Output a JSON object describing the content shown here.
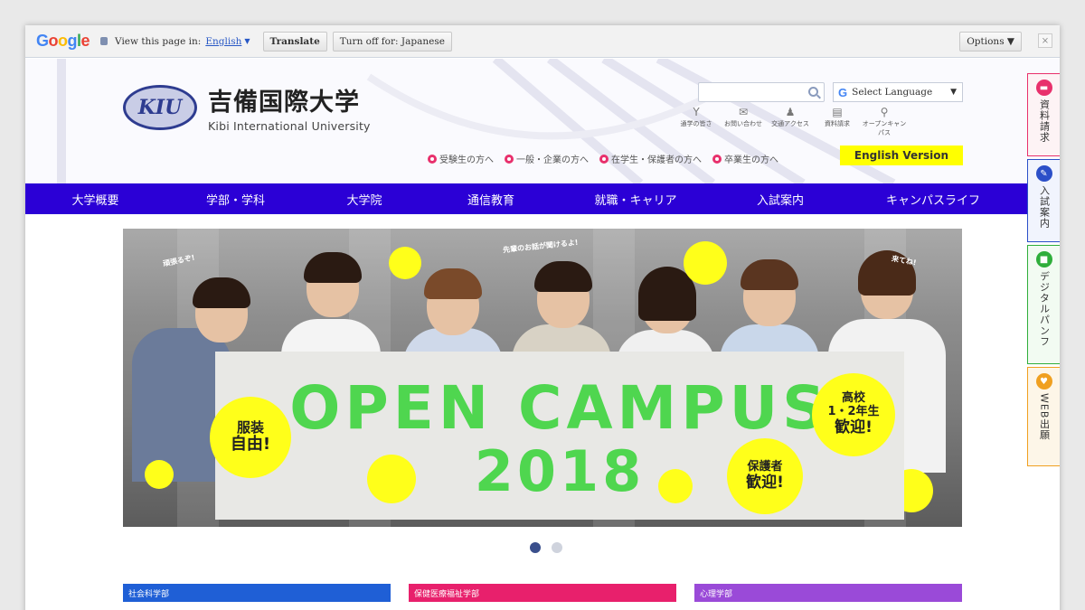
{
  "translate_bar": {
    "view_label": "View this page in:",
    "language": "English",
    "translate_btn": "Translate",
    "turn_off_btn": "Turn off for: Japanese",
    "options_btn": "Options ▼",
    "close": "×"
  },
  "header": {
    "logo_mark": "KIU",
    "logo_jp": "吉備国際大学",
    "logo_en": "Kibi International University",
    "search_placeholder": "",
    "select_language": "Select Language",
    "utilities": [
      {
        "icon": "antenna-icon",
        "glyph": "Y",
        "label": "通学の皆さ"
      },
      {
        "icon": "mail-icon",
        "glyph": "✉",
        "label": "お問い合わせ"
      },
      {
        "icon": "person-icon",
        "glyph": "♟",
        "label": "交通アクセス"
      },
      {
        "icon": "document-icon",
        "glyph": "▤",
        "label": "資料請求"
      },
      {
        "icon": "bicycle-icon",
        "glyph": "⚲",
        "label": "オープンキャンパス"
      }
    ],
    "audience_links": [
      "受験生の方へ",
      "一般・企業の方へ",
      "在学生・保護者の方へ",
      "卒業生の方へ"
    ],
    "english_version": "English Version"
  },
  "nav": {
    "items": [
      "大学概要",
      "学部・学科",
      "大学院",
      "通信教育",
      "就職・キャリア",
      "入試案内",
      "キャンパスライフ"
    ]
  },
  "side_tabs": [
    {
      "label": "資料請求",
      "icon": "document-icon",
      "color": "#e8306c"
    },
    {
      "label": "入試案内",
      "icon": "pen-icon",
      "color": "#2b4fc8"
    },
    {
      "label": "デジタルパンフ",
      "icon": "book-icon",
      "color": "#2fae3b"
    },
    {
      "label": "WEB出願",
      "icon": "web-icon",
      "color": "#f0a020"
    }
  ],
  "hero": {
    "title": "OPEN CAMPUS",
    "year": "2018",
    "badge_left_1": "服装",
    "badge_left_2": "自由!",
    "badge_right_top_1": "高校",
    "badge_right_top_2": "1・2年生",
    "badge_right_top_3": "歓迎!",
    "badge_right_bottom_1": "保護者",
    "badge_right_bottom_2": "歓迎!",
    "speech_1": "頑張るぞ!",
    "speech_2": "先輩のお話が聞けるよ!",
    "speech_3": "来てね!"
  },
  "departments": [
    "社会科学部",
    "保健医療福祉学部",
    "心理学部"
  ],
  "colors": {
    "nav": "#2b00d6",
    "accent_pink": "#e8306c",
    "accent_yellow": "#ffff00",
    "banner_green": "#4fd64f"
  }
}
